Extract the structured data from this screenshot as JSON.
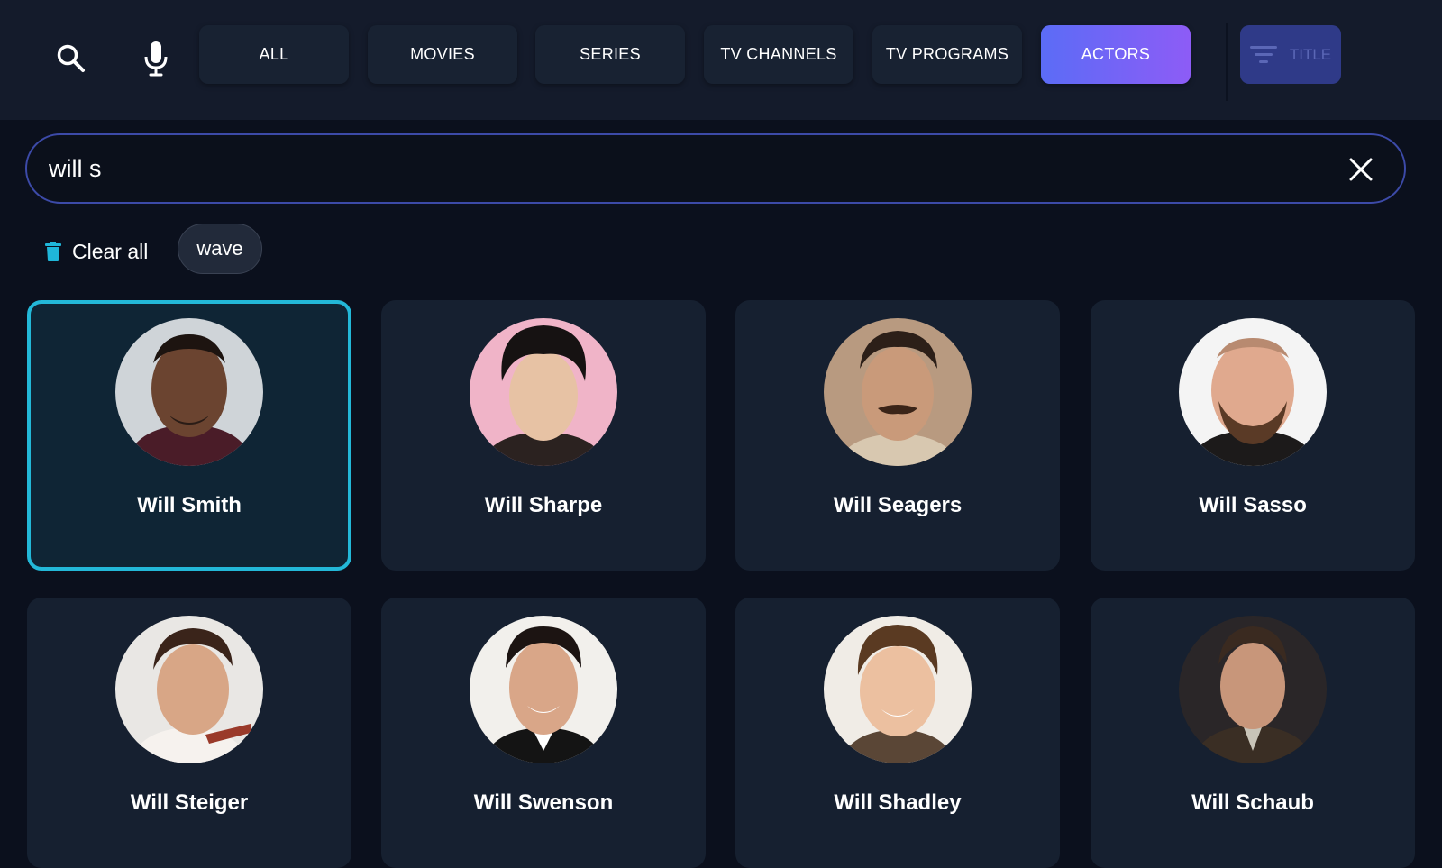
{
  "nav": {
    "tabs": [
      {
        "label": "ALL",
        "active": false
      },
      {
        "label": "MOVIES",
        "active": false
      },
      {
        "label": "SERIES",
        "active": false
      },
      {
        "label": "TV CHANNELS",
        "active": false
      },
      {
        "label": "TV PROGRAMS",
        "active": false
      },
      {
        "label": "ACTORS",
        "active": true
      }
    ],
    "sort_label": "TITLE"
  },
  "search": {
    "value": "will s"
  },
  "history": {
    "clear_all_label": "Clear all",
    "chips": [
      "wave"
    ]
  },
  "results": [
    {
      "name": "Will Smith",
      "focused": true
    },
    {
      "name": "Will Sharpe",
      "focused": false
    },
    {
      "name": "Will Seagers",
      "focused": false
    },
    {
      "name": "Will Sasso",
      "focused": false
    },
    {
      "name": "Will Steiger",
      "focused": false
    },
    {
      "name": "Will Swenson",
      "focused": false
    },
    {
      "name": "Will Shadley",
      "focused": false
    },
    {
      "name": "Will Schaub",
      "focused": false
    }
  ],
  "colors": {
    "accent_gradient_start": "#5b6cf6",
    "accent_gradient_end": "#8d5cf6",
    "focus_border": "#23b8d8",
    "background": "#0b101d"
  }
}
